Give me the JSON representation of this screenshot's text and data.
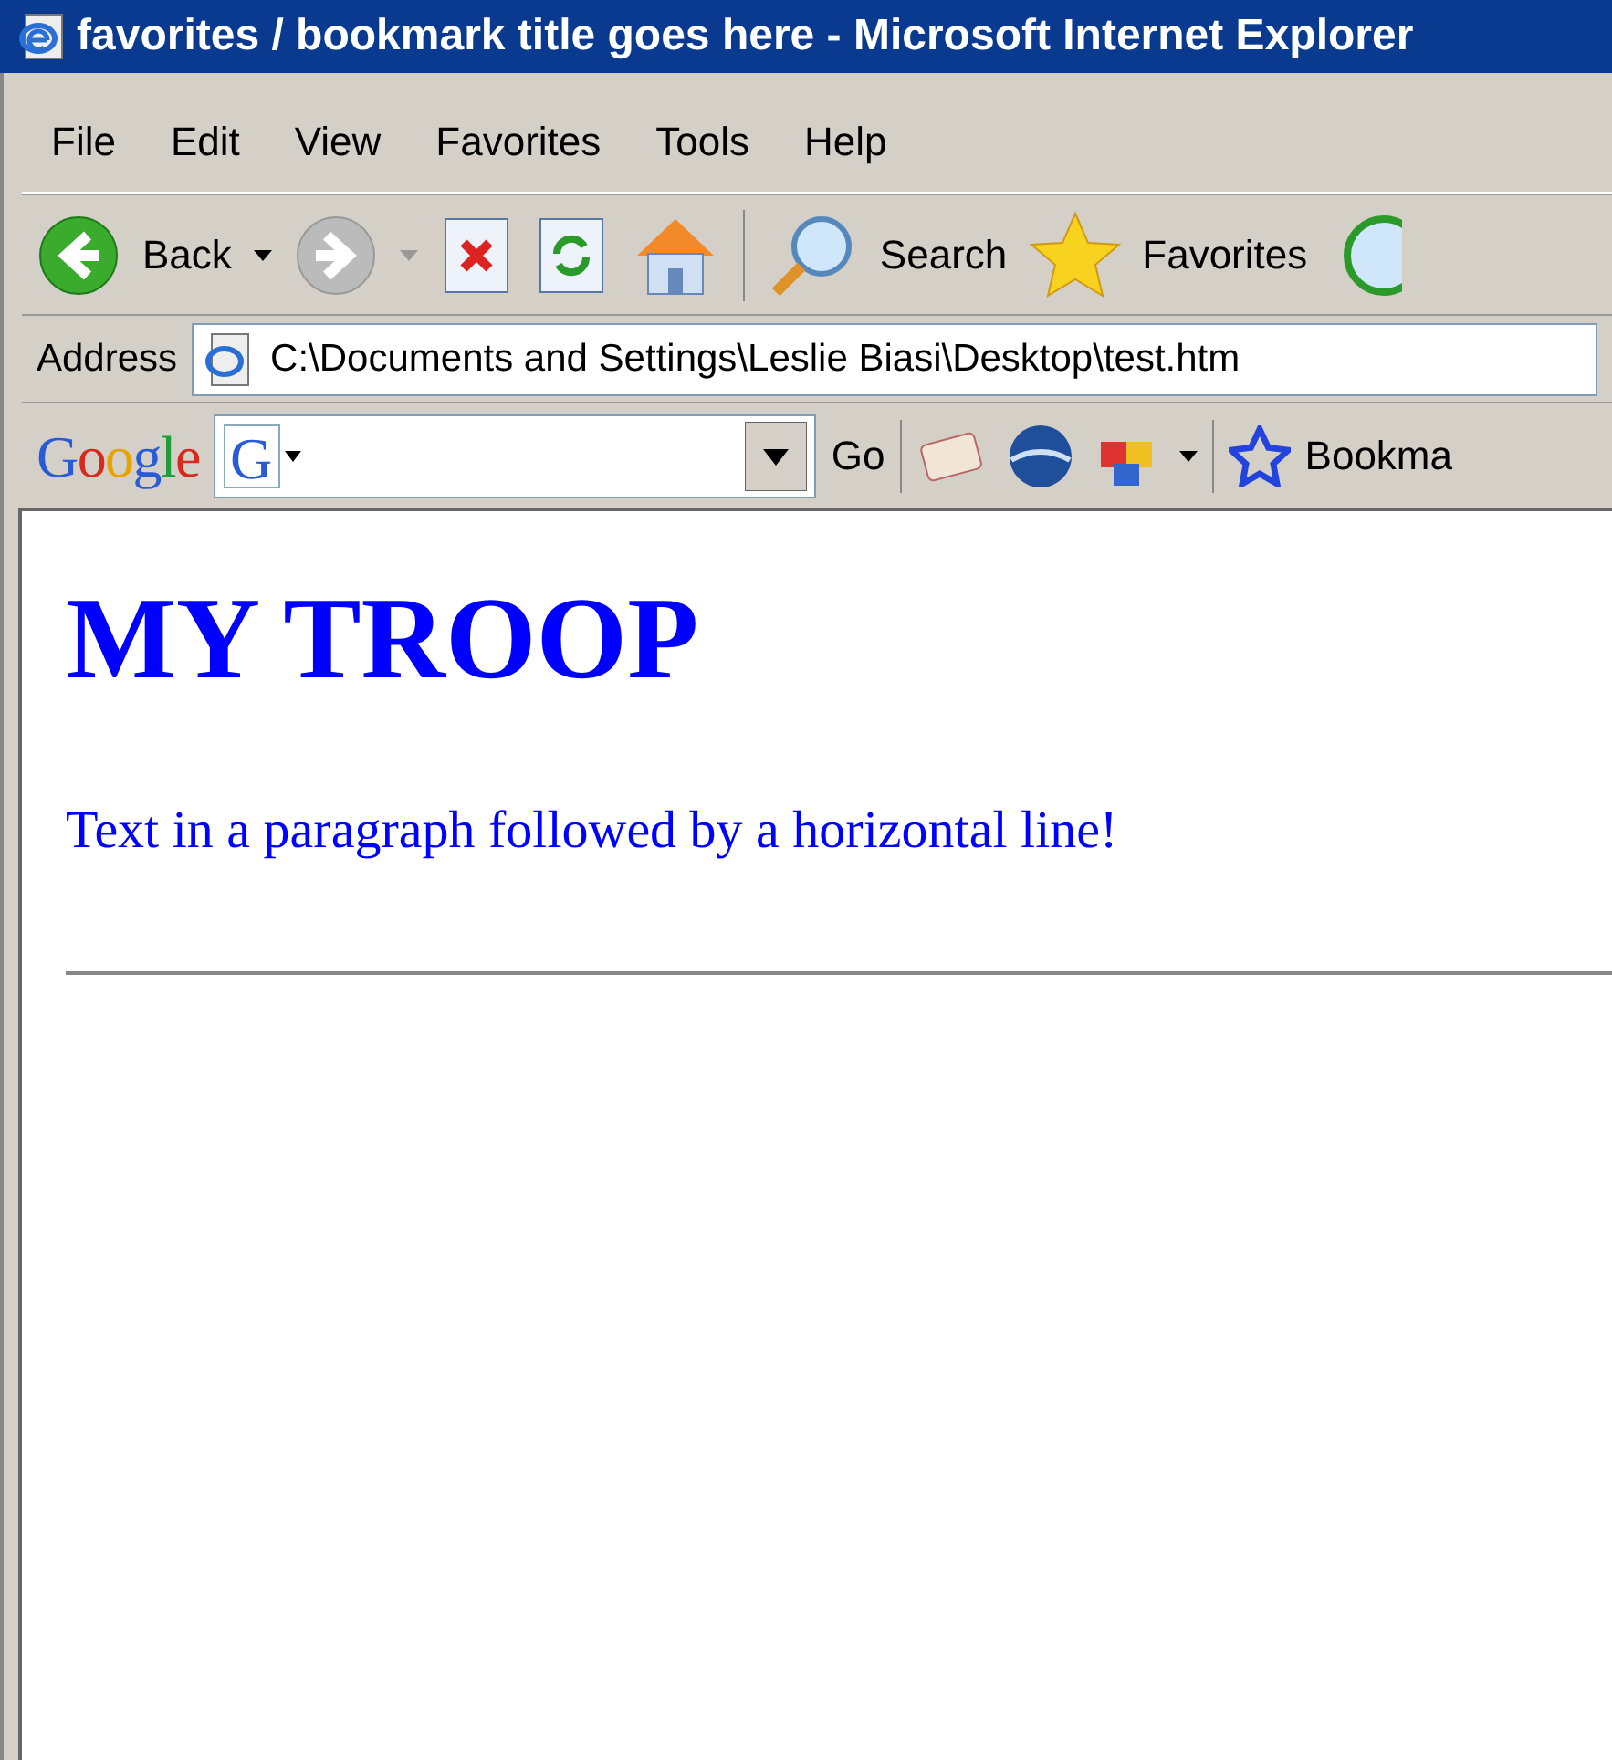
{
  "window": {
    "title": "favorites / bookmark title goes here - Microsoft Internet Explorer"
  },
  "menu": [
    "File",
    "Edit",
    "View",
    "Favorites",
    "Tools",
    "Help"
  ],
  "toolbar": {
    "back": "Back",
    "search": "Search",
    "favorites": "Favorites"
  },
  "address_bar": {
    "label": "Address",
    "value": "C:\\Documents and Settings\\Leslie Biasi\\Desktop\\test.htm"
  },
  "google_toolbar": {
    "logo": "Google",
    "g_button": "G",
    "go": "Go",
    "bookmarks": "Bookma"
  },
  "page": {
    "heading": "MY TROOP",
    "paragraph": "Text in a paragraph followed by a horizontal line!"
  }
}
